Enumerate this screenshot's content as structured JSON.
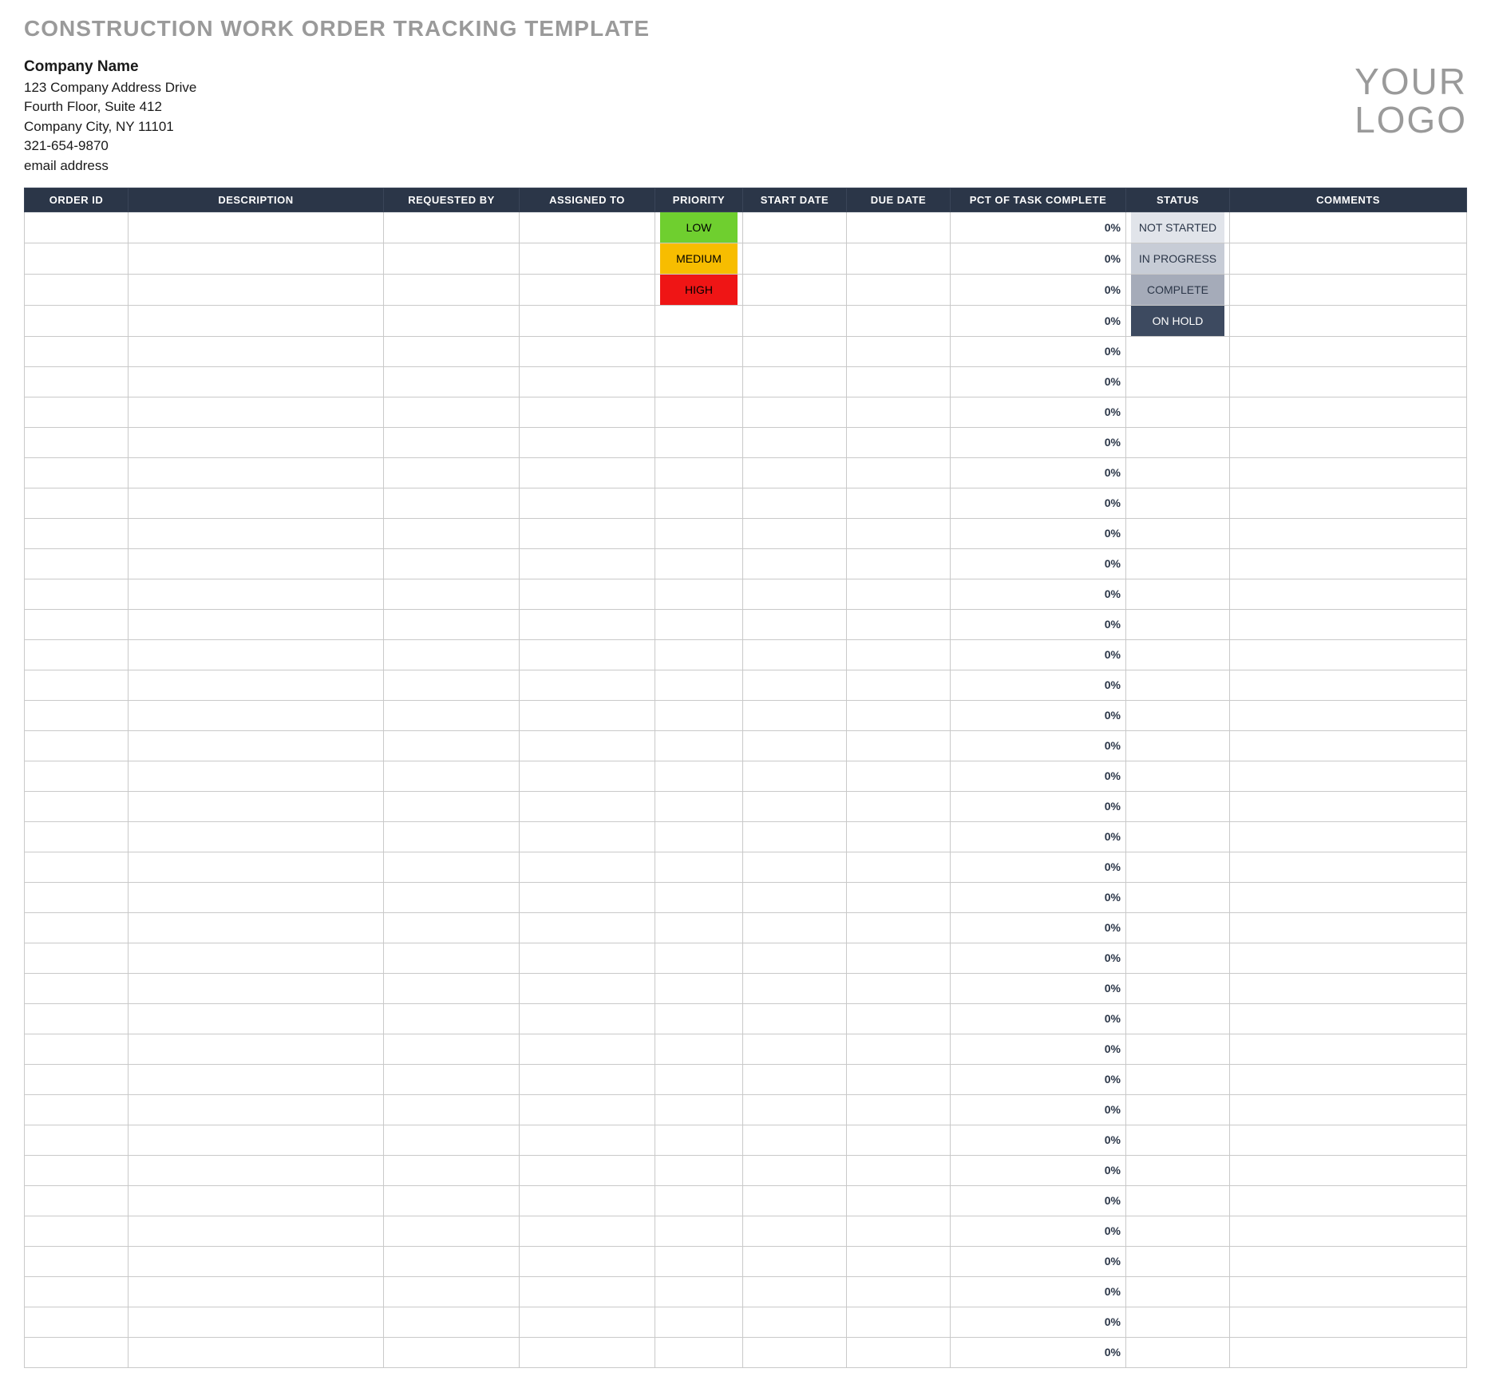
{
  "title": "CONSTRUCTION WORK ORDER TRACKING TEMPLATE",
  "company": {
    "name": "Company Name",
    "address1": "123 Company Address Drive",
    "address2": "Fourth Floor, Suite 412",
    "city_state_zip": "Company City, NY  11101",
    "phone": "321-654-9870",
    "email": "email address"
  },
  "logo": {
    "line1": "YOUR",
    "line2": "LOGO"
  },
  "columns": {
    "order_id": "ORDER ID",
    "description": "DESCRIPTION",
    "requested_by": "REQUESTED BY",
    "assigned_to": "ASSIGNED TO",
    "priority": "PRIORITY",
    "start_date": "START DATE",
    "due_date": "DUE DATE",
    "pct_complete": "PCT OF TASK COMPLETE",
    "status": "STATUS",
    "comments": "COMMENTS"
  },
  "priority_labels": {
    "low": "LOW",
    "medium": "MEDIUM",
    "high": "HIGH"
  },
  "status_labels": {
    "not_started": "NOT STARTED",
    "in_progress": "IN PROGRESS",
    "complete": "COMPLETE",
    "on_hold": "ON HOLD"
  },
  "rows": [
    {
      "priority": "low",
      "status": "not_started",
      "pct": "0%"
    },
    {
      "priority": "medium",
      "status": "in_progress",
      "pct": "0%"
    },
    {
      "priority": "high",
      "status": "complete",
      "pct": "0%"
    },
    {
      "priority": "",
      "status": "on_hold",
      "pct": "0%"
    },
    {
      "pct": "0%"
    },
    {
      "pct": "0%"
    },
    {
      "pct": "0%"
    },
    {
      "pct": "0%"
    },
    {
      "pct": "0%"
    },
    {
      "pct": "0%"
    },
    {
      "pct": "0%"
    },
    {
      "pct": "0%"
    },
    {
      "pct": "0%"
    },
    {
      "pct": "0%"
    },
    {
      "pct": "0%"
    },
    {
      "pct": "0%"
    },
    {
      "pct": "0%"
    },
    {
      "pct": "0%"
    },
    {
      "pct": "0%"
    },
    {
      "pct": "0%"
    },
    {
      "pct": "0%"
    },
    {
      "pct": "0%"
    },
    {
      "pct": "0%"
    },
    {
      "pct": "0%"
    },
    {
      "pct": "0%"
    },
    {
      "pct": "0%"
    },
    {
      "pct": "0%"
    },
    {
      "pct": "0%"
    },
    {
      "pct": "0%"
    },
    {
      "pct": "0%"
    },
    {
      "pct": "0%"
    },
    {
      "pct": "0%"
    },
    {
      "pct": "0%"
    },
    {
      "pct": "0%"
    },
    {
      "pct": "0%"
    },
    {
      "pct": "0%"
    },
    {
      "pct": "0%"
    },
    {
      "pct": "0%"
    }
  ]
}
